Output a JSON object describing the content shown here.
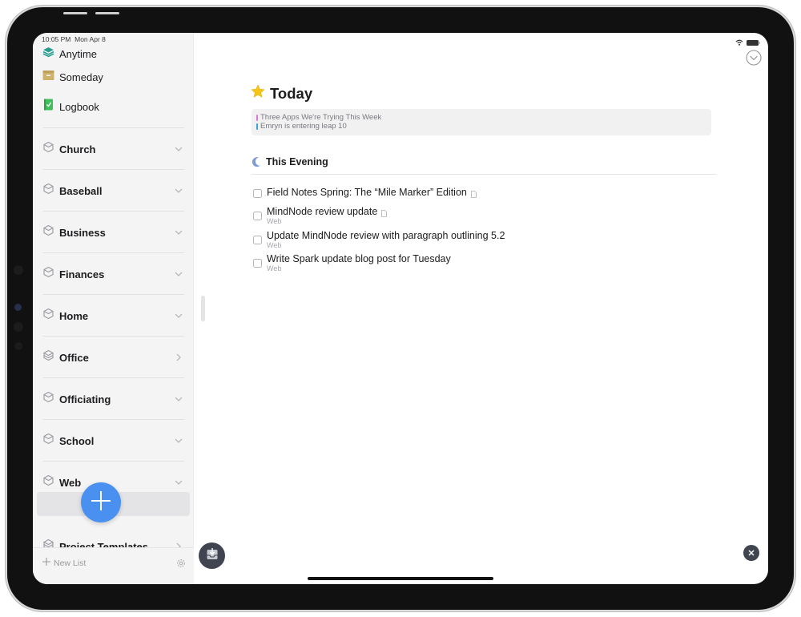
{
  "status_bar": {
    "time": "10:05 PM",
    "date": "Mon Apr 8"
  },
  "sidebar": {
    "fixed_items": [
      {
        "label": "Anytime",
        "icon": "layers-icon",
        "color": "#2a9d8f"
      },
      {
        "label": "Someday",
        "icon": "archive-box-icon",
        "color": "#cdb26e"
      },
      {
        "label": "Logbook",
        "icon": "logbook-check-icon",
        "color": "#3fbf5c"
      }
    ],
    "areas": [
      {
        "label": "Church",
        "chevron": "down"
      },
      {
        "label": "Baseball",
        "chevron": "down"
      },
      {
        "label": "Business",
        "chevron": "down"
      },
      {
        "label": "Finances",
        "chevron": "down"
      },
      {
        "label": "Home",
        "chevron": "down"
      },
      {
        "label": "Office",
        "chevron": "right"
      },
      {
        "label": "Officiating",
        "chevron": "down"
      },
      {
        "label": "School",
        "chevron": "down"
      },
      {
        "label": "Web",
        "chevron": "down"
      },
      {
        "label": "Project Templates",
        "chevron": "right"
      }
    ],
    "footer": {
      "new_list_label": "New List"
    }
  },
  "main": {
    "title": "Today",
    "calendar_events": [
      {
        "title": "Three Apps We're Trying This Week",
        "color": "#d67ad6"
      },
      {
        "title": "Emryn is entering leap 10",
        "color": "#3aa2d8"
      }
    ],
    "section": {
      "title": "This Evening"
    },
    "todos": [
      {
        "title": "Field Notes Spring: The “Mile Marker” Edition",
        "has_note": true,
        "project": ""
      },
      {
        "title": "MindNode review update",
        "has_note": true,
        "project": "Web"
      },
      {
        "title": "Update MindNode review with paragraph outlining 5.2",
        "has_note": false,
        "project": "Web"
      },
      {
        "title": "Write Spark update blog post for Tuesday",
        "has_note": false,
        "project": "Web"
      }
    ]
  },
  "colors": {
    "accent": "#4a90f0",
    "star": "#f5c518",
    "moon": "#7f9bd6"
  }
}
